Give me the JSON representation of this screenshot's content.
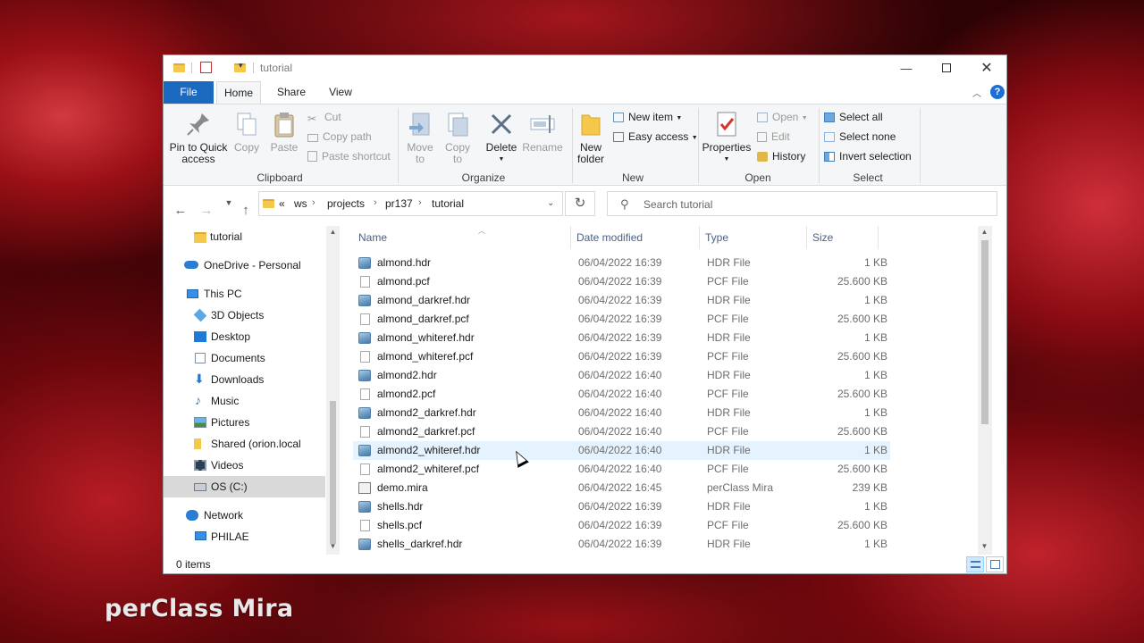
{
  "watermark": "perClass Mira",
  "titlebar": {
    "title": "tutorial",
    "minimize_icon": "minimize-icon",
    "maximize_icon": "maximize-icon",
    "close_icon": "close-icon"
  },
  "tabs": {
    "file": "File",
    "home": "Home",
    "share": "Share",
    "view": "View"
  },
  "ribbon": {
    "clipboard": {
      "label": "Clipboard",
      "pin": "Pin to Quick access",
      "copy": "Copy",
      "paste": "Paste",
      "cut": "Cut",
      "copy_path": "Copy path",
      "paste_shortcut": "Paste shortcut"
    },
    "organize": {
      "label": "Organize",
      "move_to": "Move to",
      "copy_to": "Copy to",
      "delete": "Delete",
      "rename": "Rename"
    },
    "new": {
      "label": "New",
      "new_folder": "New folder",
      "new_item": "New item",
      "easy_access": "Easy access"
    },
    "open": {
      "label": "Open",
      "properties": "Properties",
      "open": "Open",
      "edit": "Edit",
      "history": "History"
    },
    "select": {
      "label": "Select",
      "select_all": "Select all",
      "select_none": "Select none",
      "invert_selection": "Invert selection"
    }
  },
  "address": {
    "crumbs": [
      "ws",
      "projects",
      "pr137",
      "tutorial"
    ],
    "overflow": "«"
  },
  "search": {
    "placeholder": "Search tutorial"
  },
  "nav": {
    "items": [
      {
        "label": "tutorial",
        "icon": "folder-icon"
      },
      {
        "label": "OneDrive - Personal",
        "icon": "cloud-icon"
      },
      {
        "label": "This PC",
        "icon": "computer-icon"
      },
      {
        "label": "3D Objects",
        "icon": "cube-icon"
      },
      {
        "label": "Desktop",
        "icon": "desktop-icon"
      },
      {
        "label": "Documents",
        "icon": "documents-icon"
      },
      {
        "label": "Downloads",
        "icon": "download-icon"
      },
      {
        "label": "Music",
        "icon": "music-icon"
      },
      {
        "label": "Pictures",
        "icon": "pictures-icon"
      },
      {
        "label": "Shared (orion.local",
        "icon": "network-folder-icon"
      },
      {
        "label": "Videos",
        "icon": "videos-icon"
      },
      {
        "label": "OS (C:)",
        "icon": "drive-icon"
      },
      {
        "label": "Network",
        "icon": "network-icon"
      },
      {
        "label": "PHILAE",
        "icon": "computer-icon"
      }
    ]
  },
  "columns": {
    "name": "Name",
    "date": "Date modified",
    "type": "Type",
    "size": "Size"
  },
  "files": [
    {
      "name": "almond.hdr",
      "date": "06/04/2022 16:39",
      "type": "HDR File",
      "size": "1 KB",
      "kind": "hdr"
    },
    {
      "name": "almond.pcf",
      "date": "06/04/2022 16:39",
      "type": "PCF File",
      "size": "25.600 KB",
      "kind": "pcf"
    },
    {
      "name": "almond_darkref.hdr",
      "date": "06/04/2022 16:39",
      "type": "HDR File",
      "size": "1 KB",
      "kind": "hdr"
    },
    {
      "name": "almond_darkref.pcf",
      "date": "06/04/2022 16:39",
      "type": "PCF File",
      "size": "25.600 KB",
      "kind": "pcf"
    },
    {
      "name": "almond_whiteref.hdr",
      "date": "06/04/2022 16:39",
      "type": "HDR File",
      "size": "1 KB",
      "kind": "hdr"
    },
    {
      "name": "almond_whiteref.pcf",
      "date": "06/04/2022 16:39",
      "type": "PCF File",
      "size": "25.600 KB",
      "kind": "pcf"
    },
    {
      "name": "almond2.hdr",
      "date": "06/04/2022 16:40",
      "type": "HDR File",
      "size": "1 KB",
      "kind": "hdr"
    },
    {
      "name": "almond2.pcf",
      "date": "06/04/2022 16:40",
      "type": "PCF File",
      "size": "25.600 KB",
      "kind": "pcf"
    },
    {
      "name": "almond2_darkref.hdr",
      "date": "06/04/2022 16:40",
      "type": "HDR File",
      "size": "1 KB",
      "kind": "hdr"
    },
    {
      "name": "almond2_darkref.pcf",
      "date": "06/04/2022 16:40",
      "type": "PCF File",
      "size": "25.600 KB",
      "kind": "pcf"
    },
    {
      "name": "almond2_whiteref.hdr",
      "date": "06/04/2022 16:40",
      "type": "HDR File",
      "size": "1 KB",
      "kind": "hdr"
    },
    {
      "name": "almond2_whiteref.pcf",
      "date": "06/04/2022 16:40",
      "type": "PCF File",
      "size": "25.600 KB",
      "kind": "pcf"
    },
    {
      "name": "demo.mira",
      "date": "06/04/2022 16:45",
      "type": "perClass Mira",
      "size": "239 KB",
      "kind": "mira"
    },
    {
      "name": "shells.hdr",
      "date": "06/04/2022 16:39",
      "type": "HDR File",
      "size": "1 KB",
      "kind": "hdr"
    },
    {
      "name": "shells.pcf",
      "date": "06/04/2022 16:39",
      "type": "PCF File",
      "size": "25.600 KB",
      "kind": "pcf"
    },
    {
      "name": "shells_darkref.hdr",
      "date": "06/04/2022 16:39",
      "type": "HDR File",
      "size": "1 KB",
      "kind": "hdr"
    }
  ],
  "status": {
    "items": "0 items"
  },
  "colors": {
    "accent": "#1b6ac0",
    "hover_row": "#e5f3ff",
    "selected_nav": "#d9d9d9"
  }
}
